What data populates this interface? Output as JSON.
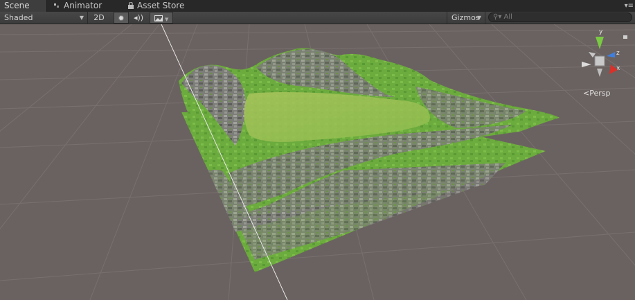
{
  "tabs": [
    {
      "label": "Scene"
    },
    {
      "label": "Animator"
    },
    {
      "label": "Asset Store"
    }
  ],
  "toolbar": {
    "shading_mode": "Shaded",
    "mode_2d": "2D",
    "gizmos_label": "Gizmos",
    "search_placeholder": "All"
  },
  "scene_gizmo": {
    "y_label": "y",
    "z_label": "z",
    "x_label": "x",
    "projection_label": "Persp"
  },
  "colors": {
    "grid_background": "#6a6260",
    "grass": "#6dab3e",
    "rock": "#8a8a86",
    "y_axis": "#7ac943",
    "z_axis": "#3f7fe0",
    "x_axis": "#d9302a"
  }
}
